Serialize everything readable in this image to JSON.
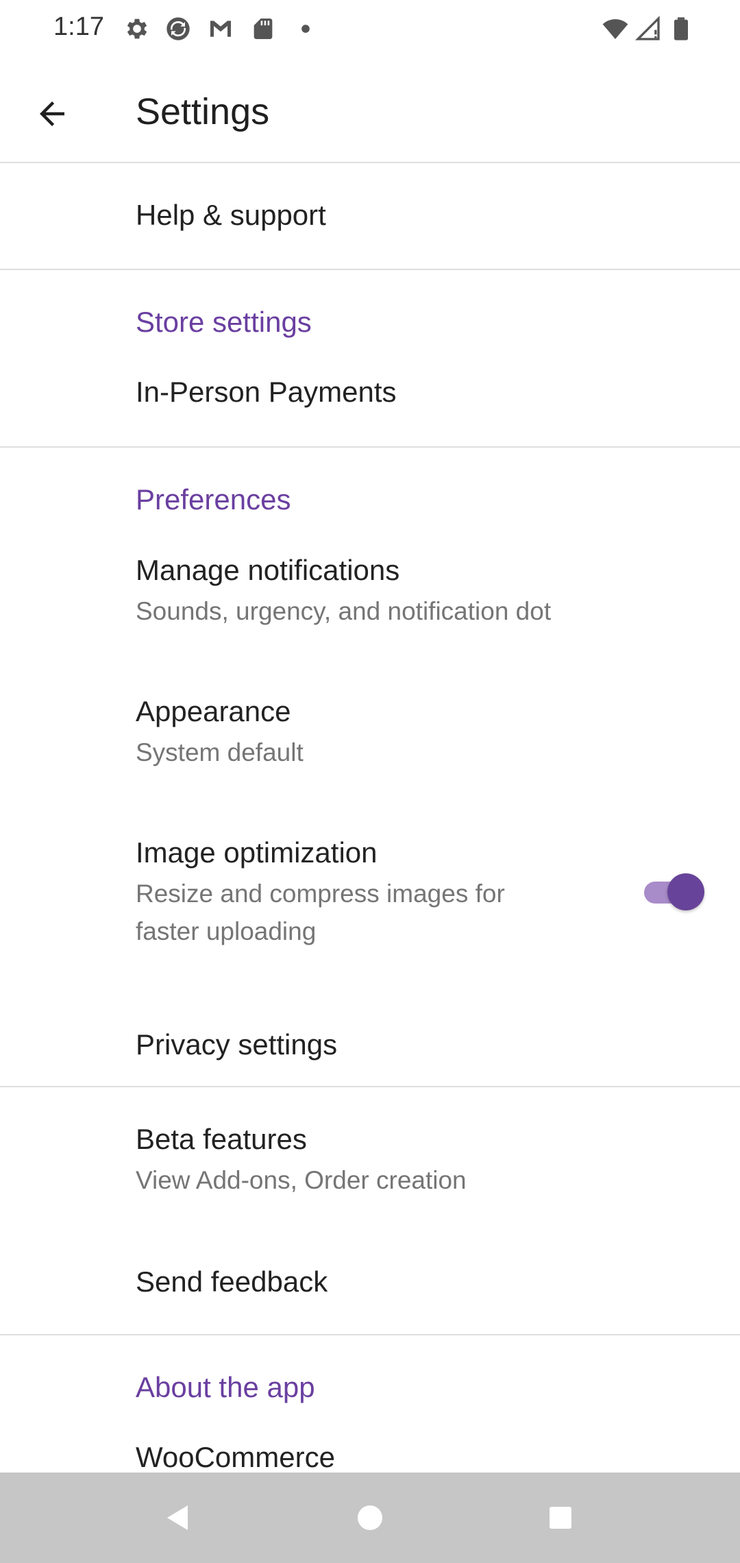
{
  "status_bar": {
    "time": "1:17",
    "left_icons": [
      "gear-icon",
      "sync-icon",
      "gmail-icon",
      "sd-card-icon",
      "dot-icon"
    ],
    "right_icons": [
      "wifi-icon",
      "signal-icon",
      "battery-icon"
    ]
  },
  "app_bar": {
    "title": "Settings",
    "back_icon": "arrow-back-icon"
  },
  "items": {
    "help": {
      "title": "Help & support"
    },
    "store_header": "Store settings",
    "in_person": {
      "title": "In-Person Payments"
    },
    "preferences_header": "Preferences",
    "notifications": {
      "title": "Manage notifications",
      "subtitle": "Sounds, urgency, and notification dot"
    },
    "appearance": {
      "title": "Appearance",
      "subtitle": "System default"
    },
    "image_opt": {
      "title": "Image optimization",
      "subtitle": "Resize and compress images for faster uploading",
      "enabled": true
    },
    "privacy": {
      "title": "Privacy settings"
    },
    "beta": {
      "title": "Beta features",
      "subtitle": "View Add-ons, Order creation"
    },
    "feedback": {
      "title": "Send feedback"
    },
    "about_header": "About the app",
    "woocommerce": {
      "title": "WooCommerce"
    }
  },
  "colors": {
    "accent": "#674399",
    "section_header": "#6a3fa0",
    "toggle_track": "#a88bc9",
    "divider": "#dedede",
    "nav_bar": "#c6c6c6"
  },
  "nav_bar": {
    "icons": [
      "nav-back-icon",
      "nav-home-icon",
      "nav-recents-icon"
    ]
  }
}
